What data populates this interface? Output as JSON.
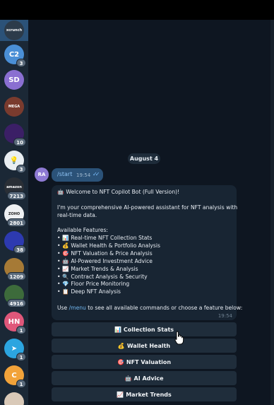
{
  "sidebar": {
    "items": [
      {
        "initials": "",
        "label": "xcrunch",
        "badge": "",
        "color": "#2c3b4a",
        "icon": "logo-xcrunch"
      },
      {
        "initials": "C2",
        "badge": "3",
        "color": "#4a8fd6",
        "icon": ""
      },
      {
        "initials": "SD",
        "badge": "",
        "color": "#8a6fd1",
        "icon": ""
      },
      {
        "initials": "",
        "label": "MEGA",
        "badge": "",
        "color": "#7a3b2e",
        "icon": "photo-avatar"
      },
      {
        "initials": "",
        "badge": "10",
        "color": "#3b1f66",
        "icon": "pixel-avatar"
      },
      {
        "initials": "",
        "badge": "3",
        "color": "#e9eef2",
        "icon": "lightbulb-avatar"
      },
      {
        "initials": "",
        "label": "amazon",
        "badge": "7213",
        "color": "#2a2f36",
        "icon": "amazon-logo"
      },
      {
        "initials": "",
        "label": "ZOHO",
        "badge": "2801",
        "color": "#eef0f2",
        "icon": "zoho-logo"
      },
      {
        "initials": "",
        "badge": "38",
        "color": "#2d3ab0",
        "icon": "spiral-avatar"
      },
      {
        "initials": "",
        "badge": "1209",
        "color": "#a67a36",
        "icon": "shield-avatar"
      },
      {
        "initials": "",
        "badge": "4916",
        "color": "#3d6b3b",
        "icon": "person-avatar"
      },
      {
        "initials": "HN",
        "badge": "1",
        "color": "#e0577a",
        "icon": ""
      },
      {
        "initials": "",
        "badge": "1",
        "color": "#2ca5e0",
        "icon": "telegram-icon"
      },
      {
        "initials": "C",
        "badge": "1",
        "color": "#f2a33a",
        "icon": ""
      },
      {
        "initials": "",
        "badge": "",
        "color": "#d9c9b8",
        "icon": "person-avatar"
      }
    ]
  },
  "chat": {
    "date": "August 4",
    "outgoing": {
      "avatar_initials": "RA",
      "text": "/start",
      "time": "19:54"
    },
    "incoming": {
      "time": "19:54",
      "lines": {
        "welcome": {
          "emoji": "🤖",
          "text": "Welcome to NFT Copilot Bot (Full Version)!"
        },
        "intro1": "I'm your comprehensive AI-powered assistant for NFT analysis with",
        "intro2": "real-time data.",
        "features_header": "Available Features:",
        "features": [
          {
            "emoji": "📊",
            "text": "Real-time NFT Collection Stats"
          },
          {
            "emoji": "💰",
            "text": "Wallet Health & Portfolio Analysis"
          },
          {
            "emoji": "🎯",
            "text": "NFT Valuation & Price Analysis"
          },
          {
            "emoji": "🤖",
            "text": "AI-Powered Investment Advice"
          },
          {
            "emoji": "📈",
            "text": "Market Trends & Analysis"
          },
          {
            "emoji": "🔍",
            "text": "Contract Analysis & Security"
          },
          {
            "emoji": "💎",
            "text": "Floor Price Monitoring"
          },
          {
            "emoji": "📋",
            "text": "Deep NFT Analysis"
          }
        ],
        "footer_prefix": "Use ",
        "footer_cmd": "/menu",
        "footer_suffix": " to see all available commands or choose a feature below:"
      }
    },
    "keyboard": [
      {
        "emoji": "📊",
        "label": "Collection Stats"
      },
      {
        "emoji": "💰",
        "label": "Wallet Health"
      },
      {
        "emoji": "🎯",
        "label": "NFT Valuation"
      },
      {
        "emoji": "🤖",
        "label": "AI Advice"
      },
      {
        "emoji": "📈",
        "label": "Market Trends"
      }
    ]
  }
}
